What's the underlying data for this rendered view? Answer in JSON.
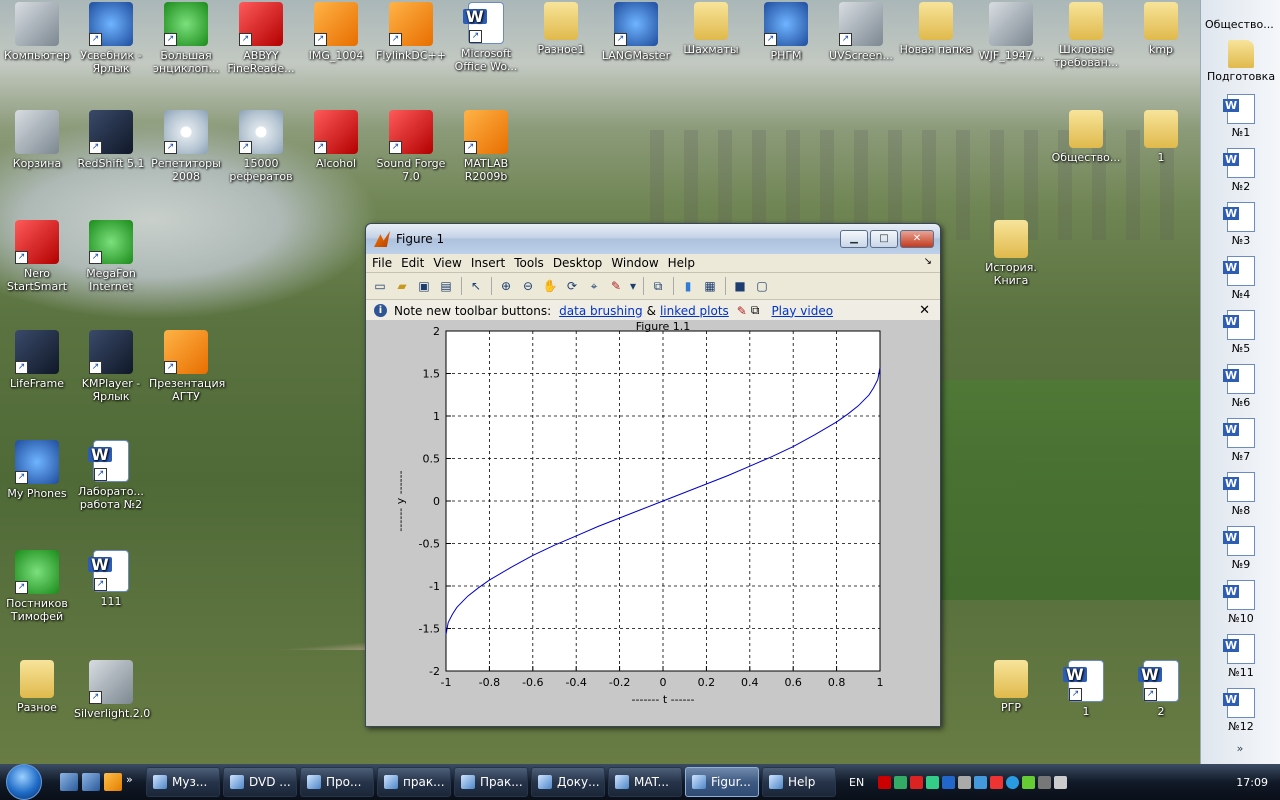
{
  "desktop": {
    "icons": [
      {
        "label": "Компьютер",
        "icon": "computer-icon"
      },
      {
        "label": "Усвебник - Ярлык",
        "icon": "internet-explorer-icon"
      },
      {
        "label": "Большая энциклоп...",
        "icon": "encyclopedia-icon"
      },
      {
        "label": "ABBYY FineReade...",
        "icon": "abbyy-icon"
      },
      {
        "label": "IMG_1004",
        "icon": "image-file-icon"
      },
      {
        "label": "FlylinkDC++",
        "icon": "flylink-icon"
      },
      {
        "label": "Microsoft Office Wo...",
        "icon": "word-icon"
      },
      {
        "label": "Разное1",
        "icon": "folder-icon"
      },
      {
        "label": "LANGMaster",
        "icon": "langmaster-icon"
      },
      {
        "label": "Шахматы",
        "icon": "folder-icon"
      },
      {
        "label": "РНГМ",
        "icon": "internet-explorer-icon"
      },
      {
        "label": "UVScreen...",
        "icon": "uvscreen-icon"
      },
      {
        "label": "Новая папка",
        "icon": "folder-icon"
      },
      {
        "label": "WJF_1947...",
        "icon": "wmv-file-icon"
      },
      {
        "label": "Шкловые требован...",
        "icon": "folder-icon"
      },
      {
        "label": "kmp",
        "icon": "folder-icon"
      },
      {
        "label": "Корзина",
        "icon": "recycle-bin-icon"
      },
      {
        "label": "RedShift 5.1",
        "icon": "redshift-icon"
      },
      {
        "label": "Репетиторы 2008",
        "icon": "cd-icon"
      },
      {
        "label": "15000 рефератов",
        "icon": "cd-icon"
      },
      {
        "label": "Alcohol",
        "icon": "alcohol-icon"
      },
      {
        "label": "Sound Forge 7.0",
        "icon": "sound-forge-icon"
      },
      {
        "label": "MATLAB R2009b",
        "icon": "matlab-icon"
      },
      {
        "label": "Общество...",
        "icon": "folder-icon"
      },
      {
        "label": "1",
        "icon": "folder-icon"
      },
      {
        "label": "Nero StartSmart",
        "icon": "nero-icon"
      },
      {
        "label": "MegaFon Internet",
        "icon": "megafon-icon"
      },
      {
        "label": "История. Книга",
        "icon": "folder-icon"
      },
      {
        "label": "LifeFrame",
        "icon": "lifeframe-icon"
      },
      {
        "label": "KMPlayer - Ярлык",
        "icon": "kmplayer-icon"
      },
      {
        "label": "Презентация АГТУ",
        "icon": "powerpoint-icon"
      },
      {
        "label": "My Phones",
        "icon": "phone-icon"
      },
      {
        "label": "Лаборато... работа №2",
        "icon": "word-icon"
      },
      {
        "label": "Постников Тимофей",
        "icon": "book-icon"
      },
      {
        "label": "111",
        "icon": "word-icon"
      },
      {
        "label": "Разное",
        "icon": "folder-icon"
      },
      {
        "label": "Silverlight.2.0",
        "icon": "silverlight-icon"
      },
      {
        "label": "РГР",
        "icon": "folder-icon"
      },
      {
        "label": "1",
        "icon": "word-icon"
      },
      {
        "label": "2",
        "icon": "word-icon"
      }
    ]
  },
  "sidebar": {
    "title": "Общество...",
    "folder_label": "Подготовка",
    "items": [
      "№1",
      "№2",
      "№3",
      "№4",
      "№5",
      "№6",
      "№7",
      "№8",
      "№9",
      "№10",
      "№11",
      "№12"
    ],
    "more": "»"
  },
  "figure": {
    "title": "Figure 1",
    "menu": [
      "File",
      "Edit",
      "View",
      "Insert",
      "Tools",
      "Desktop",
      "Window",
      "Help"
    ],
    "window_buttons": {
      "minimize": "▁",
      "maximize": "□",
      "close": "✕"
    },
    "note": {
      "prefix": "Note new toolbar buttons:",
      "link1": "data brushing",
      "amp": "&",
      "link2": "linked plots",
      "link3": "Play video",
      "close": "✕"
    },
    "plot_title": "Figure 1.1",
    "toolbar": [
      "new-figure-icon",
      "open-icon",
      "save-icon",
      "print-icon",
      "pointer-icon",
      "zoom-in-icon",
      "zoom-out-icon",
      "pan-icon",
      "rotate-icon",
      "data-cursor-icon",
      "brush-icon",
      "link-icon",
      "colorbar-icon",
      "legend-icon",
      "hide-tools-icon",
      "show-tools-icon"
    ]
  },
  "chart_data": {
    "type": "line",
    "xlabel": "------- t ------",
    "ylabel": "------ y ------",
    "xlim": [
      -1,
      1
    ],
    "ylim": [
      -2,
      2
    ],
    "xticks": [
      "-1",
      "-0.8",
      "-0.6",
      "-0.4",
      "-0.2",
      "0",
      "0.2",
      "0.4",
      "0.6",
      "0.8",
      "1"
    ],
    "yticks": [
      "-2",
      "-1.5",
      "-1",
      "-0.5",
      "0",
      "0.5",
      "1",
      "1.5",
      "2"
    ],
    "grid": true,
    "grid_style": "dashed",
    "series": [
      {
        "color": "#0000cc",
        "x": [
          -1,
          -0.99,
          -0.97,
          -0.95,
          -0.9,
          -0.85,
          -0.8,
          -0.7,
          -0.6,
          -0.5,
          -0.4,
          -0.3,
          -0.2,
          -0.1,
          0,
          0.1,
          0.2,
          0.3,
          0.4,
          0.5,
          0.6,
          0.7,
          0.8,
          0.85,
          0.9,
          0.95,
          0.97,
          0.99,
          1
        ],
        "y": [
          -1.57,
          -1.43,
          -1.33,
          -1.25,
          -1.12,
          -1.02,
          -0.93,
          -0.78,
          -0.64,
          -0.52,
          -0.41,
          -0.3,
          -0.2,
          -0.1,
          0,
          0.1,
          0.2,
          0.3,
          0.41,
          0.52,
          0.64,
          0.78,
          0.93,
          1.02,
          1.12,
          1.25,
          1.33,
          1.43,
          1.57
        ]
      }
    ]
  },
  "taskbar": {
    "tasks": [
      "Муз...",
      "DVD ...",
      "Про...",
      "прак...",
      "Прак...",
      "Доку...",
      "MAT...",
      "Figur...",
      "Help"
    ],
    "active_index": 7,
    "language": "EN",
    "clock": "17:09",
    "quicklaunch_more": "»"
  }
}
